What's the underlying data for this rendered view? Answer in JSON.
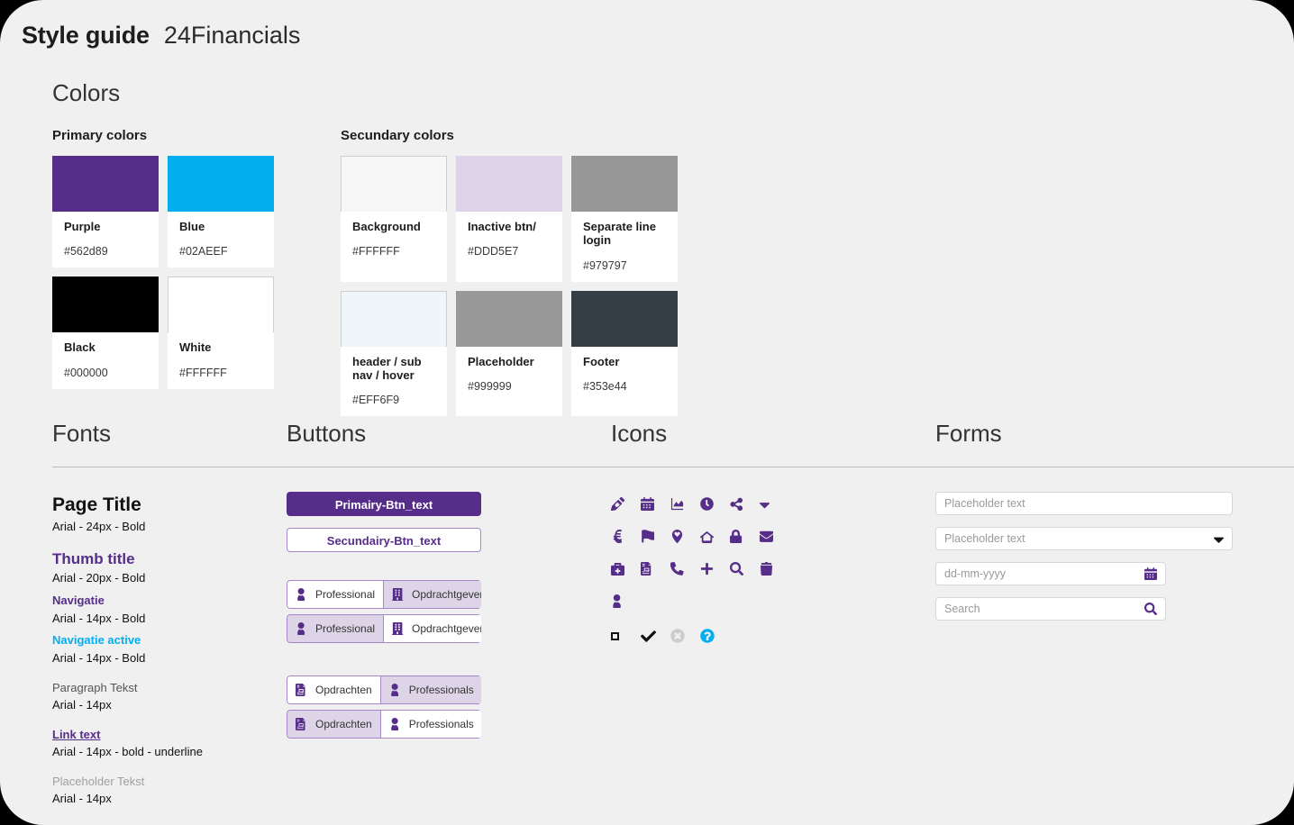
{
  "header": {
    "title": "Style guide",
    "subtitle": "24Financials"
  },
  "colors": {
    "heading": "Colors",
    "primary": {
      "group_title": "Primary colors",
      "swatches": [
        {
          "name": "Purple",
          "hex": "#562d89",
          "fill": "#562d89",
          "bordered": false
        },
        {
          "name": "Blue",
          "hex": "#02AEEF",
          "fill": "#02AEEF",
          "bordered": false
        },
        {
          "name": "Black",
          "hex": "#000000",
          "fill": "#000000",
          "bordered": false
        },
        {
          "name": "White",
          "hex": "#FFFFFF",
          "fill": "#ffffff",
          "bordered": true
        }
      ]
    },
    "secondary": {
      "group_title": "Secundary colors",
      "swatches": [
        {
          "name": "Background",
          "hex": "#FFFFFF",
          "fill": "#f7f7f7",
          "bordered": true
        },
        {
          "name": "Inactive btn/",
          "hex": "#DDD5E7",
          "fill": "#ddd5e7",
          "bordered": false
        },
        {
          "name": "Separate line login",
          "hex": "#979797",
          "fill": "#979797",
          "bordered": false
        },
        {
          "name": "header / sub nav / hover",
          "hex": "#EFF6F9",
          "fill": "#eff6f9",
          "bordered": true
        },
        {
          "name": "Placeholder",
          "hex": "#999999",
          "fill": "#999999",
          "bordered": false
        },
        {
          "name": "Footer",
          "hex": "#353e44",
          "fill": "#353e44",
          "bordered": false
        }
      ]
    }
  },
  "fonts": {
    "heading": "Fonts",
    "rows": [
      {
        "sample": "Page Title",
        "spec": "Arial - 24px - Bold",
        "style": "s-page-title"
      },
      {
        "sample": "Thumb title",
        "spec": "Arial - 20px - Bold",
        "style": "s-thumb-title"
      },
      {
        "sample": "Navigatie",
        "spec": "Arial - 14px - Bold",
        "style": "s-nav"
      },
      {
        "sample": "Navigatie active",
        "spec": "Arial - 14px - Bold",
        "style": "s-nav-active"
      },
      {
        "sample": "Paragraph Tekst",
        "spec": "Arial - 14px",
        "style": "s-paragraph"
      },
      {
        "sample": "Link text",
        "spec": "Arial - 14px - bold - underline",
        "style": "s-link"
      },
      {
        "sample": "Placeholder Tekst",
        "spec": "Arial - 14px",
        "style": "s-placeholder"
      }
    ]
  },
  "buttons": {
    "heading": "Buttons",
    "primary_label": "Primairy-Btn_text",
    "secondary_label": "Secundairy-Btn_text",
    "toggles": [
      {
        "segments": [
          {
            "label": "Professional",
            "icon": "user-icon",
            "active": false
          },
          {
            "label": "Opdrachtgever",
            "icon": "building-icon",
            "active": true
          }
        ]
      },
      {
        "segments": [
          {
            "label": "Professional",
            "icon": "user-icon",
            "active": true
          },
          {
            "label": "Opdrachtgever",
            "icon": "building-icon",
            "active": false
          }
        ]
      },
      {
        "segments": [
          {
            "label": "Opdrachten",
            "icon": "file-invoice-icon",
            "active": false
          },
          {
            "label": "Professionals",
            "icon": "user-icon",
            "active": true
          }
        ]
      },
      {
        "segments": [
          {
            "label": "Opdrachten",
            "icon": "file-invoice-icon",
            "active": true
          },
          {
            "label": "Professionals",
            "icon": "user-icon",
            "active": false
          }
        ]
      }
    ]
  },
  "icons": {
    "heading": "Icons",
    "accent": "#562d89",
    "rows": [
      [
        "pencil-icon",
        "calendar-icon",
        "area-chart-icon",
        "clock-icon",
        "share-icon",
        "caret-down-icon"
      ],
      [
        "euro-icon",
        "flag-icon",
        "map-pin-heart-icon",
        "home-icon",
        "lock-icon",
        "envelope-icon"
      ],
      [
        "briefcase-medical-icon",
        "file-invoice-icon",
        "phone-icon",
        "plus-icon",
        "search-icon",
        "trash-icon"
      ],
      [
        "user-icon"
      ]
    ],
    "states": [
      "checkbox-empty-icon",
      "check-icon",
      "circle-x-icon",
      "question-circle-icon"
    ],
    "state_colors": {
      "checkbox-empty-icon": "#111111",
      "check-icon": "#111111",
      "circle-x-icon": "#cccccc",
      "question-circle-icon": "#02AEEF"
    }
  },
  "forms": {
    "heading": "Forms",
    "fields": [
      {
        "kind": "text",
        "placeholder": "Placeholder text",
        "value": "",
        "adorn": "none"
      },
      {
        "kind": "select",
        "placeholder": "Placeholder text",
        "value": "",
        "adorn": "caret-down-icon"
      },
      {
        "kind": "date",
        "placeholder": "dd-mm-yyyy",
        "value": "",
        "adorn": "calendar-icon"
      },
      {
        "kind": "search",
        "placeholder": "Search",
        "value": "",
        "adorn": "search-icon"
      }
    ]
  }
}
